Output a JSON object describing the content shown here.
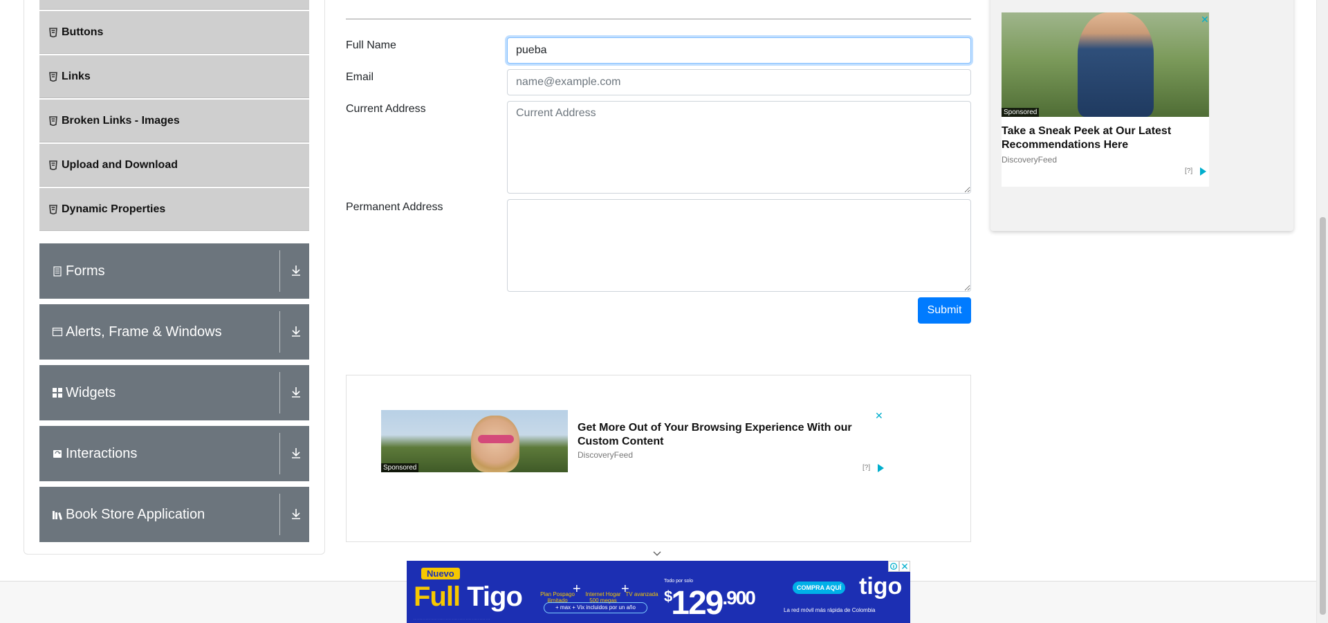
{
  "sidebar": {
    "element_items": [
      {
        "label": "Buttons"
      },
      {
        "label": "Links"
      },
      {
        "label": "Broken Links - Images"
      },
      {
        "label": "Upload and Download"
      },
      {
        "label": "Dynamic Properties"
      }
    ],
    "groups": [
      {
        "label": "Forms",
        "icon": "form-icon"
      },
      {
        "label": "Alerts, Frame & Windows",
        "icon": "window-icon"
      },
      {
        "label": "Widgets",
        "icon": "widgets-icon"
      },
      {
        "label": "Interactions",
        "icon": "interactions-icon"
      },
      {
        "label": "Book Store Application",
        "icon": "bookstore-icon"
      }
    ]
  },
  "form": {
    "full_name_label": "Full Name",
    "full_name_value": "pueba",
    "email_label": "Email",
    "email_placeholder": "name@example.com",
    "current_address_label": "Current Address",
    "current_address_placeholder": "Current Address",
    "permanent_address_label": "Permanent Address",
    "submit_label": "Submit"
  },
  "ad_bottom": {
    "title": "Get More Out of Your Browsing Experience With our Custom Content",
    "source": "DiscoveryFeed",
    "sponsored": "Sponsored",
    "close": "✕",
    "help": "[?]"
  },
  "ad_right": {
    "title": "Take a Sneak Peek at Our Latest Recommendations Here",
    "source": "DiscoveryFeed",
    "sponsored": "Sponsored",
    "close": "✕",
    "help": "[?]"
  },
  "banner": {
    "nuevo": "Nuevo",
    "full": "Full",
    "brand_word": "Tigo",
    "feature1": "Plan Pospago ilimitado",
    "feature2": "Internet Hogar 500 megas",
    "feature3": "TV avanzada",
    "pill": "+ max + Vix incluidos por un año",
    "todo": "Todo por solo",
    "currency": "$",
    "price_main": "129",
    "price_dec": ".900",
    "cta": "COMPRA AQUÍ",
    "brand": "tigo",
    "tagline": "La red móvil más rápida de Colombia"
  },
  "colors": {
    "primary": "#007bff",
    "group_bg": "#6c757d",
    "menu_bg": "#cfcfcf",
    "banner_bg": "#1c2fb3",
    "banner_accent": "#f7c800"
  }
}
